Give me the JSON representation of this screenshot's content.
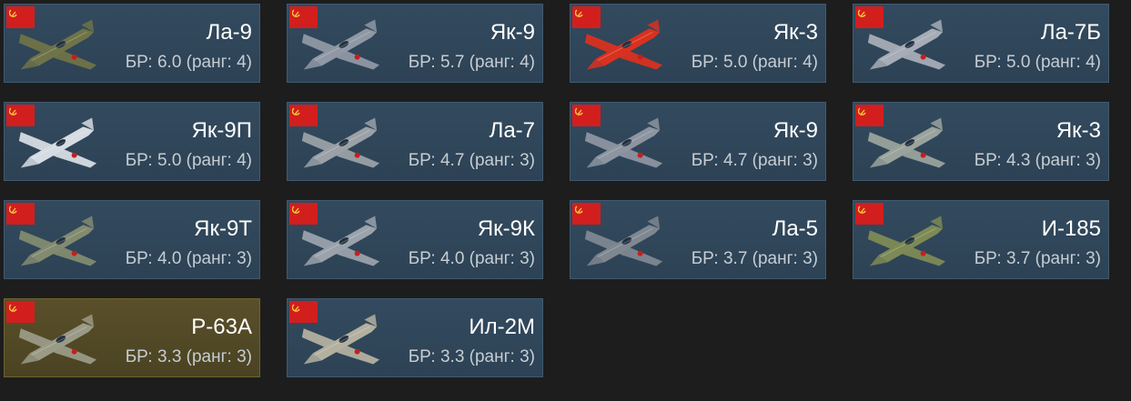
{
  "colors": {
    "card": "#334a5e",
    "premium_card": "#5a4f2a",
    "flag": "#d31e1e",
    "background": "#1d1d1d"
  },
  "vehicles": [
    {
      "name": "Ла-9",
      "br": "БР: 6.0 (ранг: 4)",
      "plane_color": "#6f7348",
      "icon": "soviet-flag-icon"
    },
    {
      "name": "Як-9",
      "br": "БР: 5.7 (ранг: 4)",
      "plane_color": "#8f98a4",
      "icon": "soviet-flag-icon"
    },
    {
      "name": "Як-3",
      "br": "БР: 5.0 (ранг: 4)",
      "plane_color": "#d9311f",
      "icon": "soviet-flag-icon"
    },
    {
      "name": "Ла-7Б",
      "br": "БР: 5.0 (ранг: 4)",
      "plane_color": "#a6adb6",
      "icon": "soviet-flag-icon"
    },
    {
      "name": "Як-9П",
      "br": "БР: 5.0 (ранг: 4)",
      "plane_color": "#d6dce3",
      "icon": "soviet-flag-icon"
    },
    {
      "name": "Ла-7",
      "br": "БР: 4.7 (ранг: 3)",
      "plane_color": "#9aa1a7",
      "icon": "soviet-flag-icon"
    },
    {
      "name": "Як-9",
      "br": "БР: 4.7 (ранг: 3)",
      "plane_color": "#8c95a0",
      "icon": "soviet-flag-icon"
    },
    {
      "name": "Як-3",
      "br": "БР: 4.3 (ранг: 3)",
      "plane_color": "#9aa39c",
      "icon": "soviet-flag-icon"
    },
    {
      "name": "Як-9Т",
      "br": "БР: 4.0 (ранг: 3)",
      "plane_color": "#828b70",
      "icon": "soviet-flag-icon"
    },
    {
      "name": "Як-9К",
      "br": "БР: 4.0 (ранг: 3)",
      "plane_color": "#9aa2ac",
      "icon": "soviet-flag-icon"
    },
    {
      "name": "Ла-5",
      "br": "БР: 3.7 (ранг: 3)",
      "plane_color": "#7f8791",
      "icon": "soviet-flag-icon"
    },
    {
      "name": "И-185",
      "br": "БР: 3.7 (ранг: 3)",
      "plane_color": "#7d8a55",
      "icon": "soviet-flag-icon"
    },
    {
      "name": "P-63A",
      "br": "БР: 3.3 (ранг: 3)",
      "plane_color": "#9a9a86",
      "icon": "soviet-flag-icon",
      "premium": true
    },
    {
      "name": "Ил-2М",
      "br": "БР: 3.3 (ранг: 3)",
      "plane_color": "#b3b0a0",
      "icon": "soviet-flag-icon"
    }
  ]
}
